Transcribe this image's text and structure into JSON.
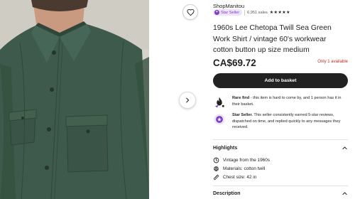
{
  "listing": {
    "shop_name": "ShopManitou",
    "star_seller_badge": "Star Seller",
    "sales_count": "6,951 sales",
    "rating_stars": "★★★★★",
    "title": "1960s Lee Chetopa Twill Sea Green Work Shirt / vintage 60's workwear cotton button up size medium",
    "price": "CA$69.72",
    "stock_note": "Only 1 available",
    "add_to_basket_label": "Add to basket"
  },
  "features": {
    "rare_find_title": "Rare find",
    "rare_find_text": " - this item is hard to come by, and 1 person has it in their basket.",
    "star_seller_title": "Star Seller.",
    "star_seller_text": " This seller consistently earned 5-star reviews, dispatched on time, and replied quickly to any messages they received."
  },
  "highlights": {
    "heading": "Highlights",
    "items": [
      {
        "icon": "clock-icon",
        "text": "Vintage from the 1960s"
      },
      {
        "icon": "material-icon",
        "text": "Materials: cotton twill"
      },
      {
        "icon": "ruler-icon",
        "text": "Chest size: 42 in"
      }
    ]
  },
  "description": {
    "heading": "Description"
  },
  "colors": {
    "shirt": "#3e5a4c",
    "brand_purple": "#7e3ec3",
    "stock_red": "#b32f28",
    "button_dark": "#222222"
  }
}
